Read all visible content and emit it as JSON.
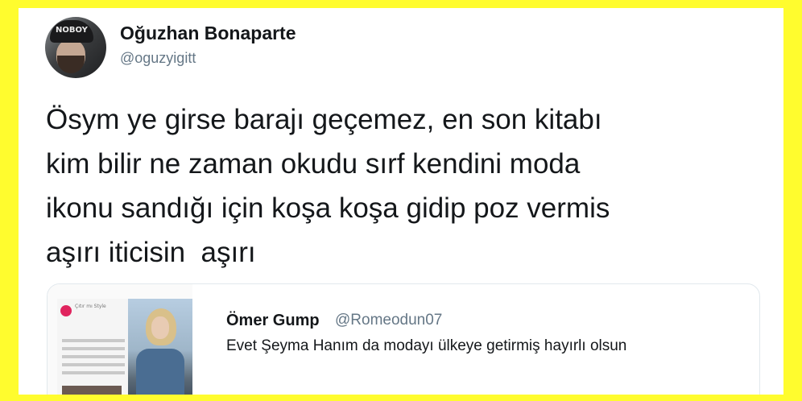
{
  "tweet": {
    "author_name": "Oğuzhan Bonaparte",
    "author_handle": "@oguzyigitt",
    "avatar_cap_text": "NOBOY",
    "text_lines": [
      "Ösym ye girse barajı geçemez, en son kitabı",
      "kim bilir ne zaman okudu sırf kendini moda",
      "ikonu sandığı için koşa koşa gidip poz vermis",
      "aşırı iticisin  aşırı"
    ]
  },
  "quoted_tweet": {
    "author_name": "Ömer Gump",
    "author_handle": "@Romeodun07",
    "text": "Evet Şeyma Hanım da modayı ülkeye getirmiş hayırlı olsun",
    "media_logo_text": "Çıtır mı Style"
  },
  "colors": {
    "frame_border": "#fffc2e",
    "text_primary": "#14171a",
    "text_secondary": "#657786",
    "quote_border": "#e1e8ed"
  }
}
